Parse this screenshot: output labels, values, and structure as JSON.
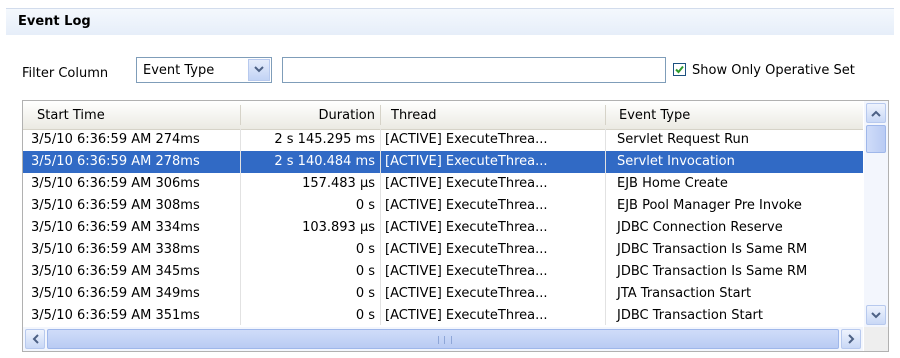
{
  "panel": {
    "title": "Event Log"
  },
  "filter": {
    "label": "Filter Column",
    "column_value": "Event Type",
    "text_value": "",
    "show_operative_label": "Show Only Operative Set",
    "show_operative_checked": true
  },
  "table": {
    "columns": [
      "Start Time",
      "Duration",
      "Thread",
      "Event Type"
    ],
    "selected_row": 1,
    "rows": [
      [
        "3/5/10 6:36:59 AM 274ms",
        "2 s 145.295 ms",
        "[ACTIVE] ExecuteThrea...",
        "Servlet Request Run"
      ],
      [
        "3/5/10 6:36:59 AM 278ms",
        "2 s 140.484 ms",
        "[ACTIVE] ExecuteThrea...",
        "Servlet Invocation"
      ],
      [
        "3/5/10 6:36:59 AM 306ms",
        "157.483 µs",
        "[ACTIVE] ExecuteThrea...",
        "EJB Home Create"
      ],
      [
        "3/5/10 6:36:59 AM 308ms",
        "0 s",
        "[ACTIVE] ExecuteThrea...",
        "EJB Pool Manager Pre Invoke"
      ],
      [
        "3/5/10 6:36:59 AM 334ms",
        "103.893 µs",
        "[ACTIVE] ExecuteThrea...",
        "JDBC Connection Reserve"
      ],
      [
        "3/5/10 6:36:59 AM 338ms",
        "0 s",
        "[ACTIVE] ExecuteThrea...",
        "JDBC Transaction Is Same RM"
      ],
      [
        "3/5/10 6:36:59 AM 345ms",
        "0 s",
        "[ACTIVE] ExecuteThrea...",
        "JDBC Transaction Is Same RM"
      ],
      [
        "3/5/10 6:36:59 AM 349ms",
        "0 s",
        "[ACTIVE] ExecuteThrea...",
        "JTA Transaction Start"
      ],
      [
        "3/5/10 6:36:59 AM 351ms",
        "0 s",
        "[ACTIVE] ExecuteThrea...",
        "JDBC Transaction Start"
      ]
    ]
  },
  "icons": {
    "dropdown": "chevron-down-icon",
    "check": "checkmark-icon",
    "scroll_up": "arrow-up-icon",
    "scroll_down": "arrow-down-icon",
    "scroll_left": "arrow-left-icon",
    "scroll_right": "arrow-right-icon"
  },
  "colors": {
    "selection": "#316ac5",
    "accent": "#316ac5",
    "checkmark": "#2d9a2d"
  }
}
